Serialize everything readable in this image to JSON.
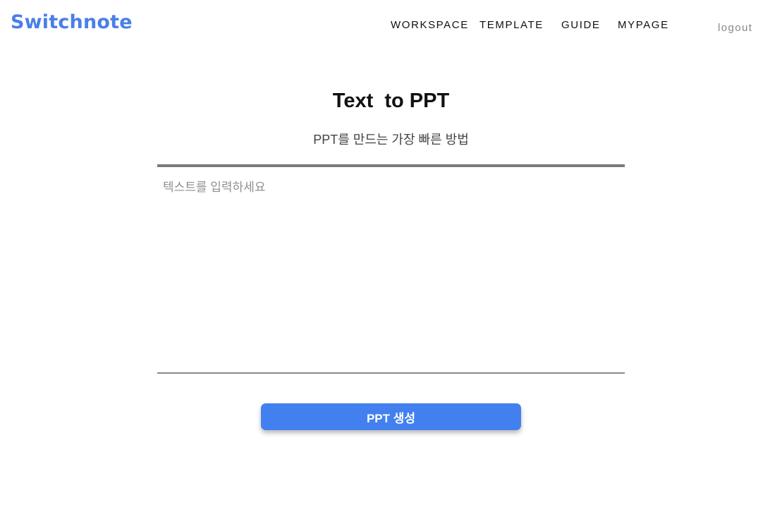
{
  "header": {
    "logo": "Switchnote",
    "nav": {
      "workspace": "WORKSPACE",
      "template": "TEMPLATE",
      "guide": "GUIDE",
      "mypage": "MYPAGE"
    },
    "logout": "logout"
  },
  "main": {
    "title": "Text  to PPT",
    "subtitle": "PPT를 만드는 가장 빠른 방법",
    "input": {
      "placeholder": "텍스트를 입력하세요",
      "value": ""
    },
    "generate_button": "PPT 생성"
  },
  "colors": {
    "brand": "#4a7fe8",
    "button": "#4380ef",
    "divider": "#7a7a7a"
  }
}
